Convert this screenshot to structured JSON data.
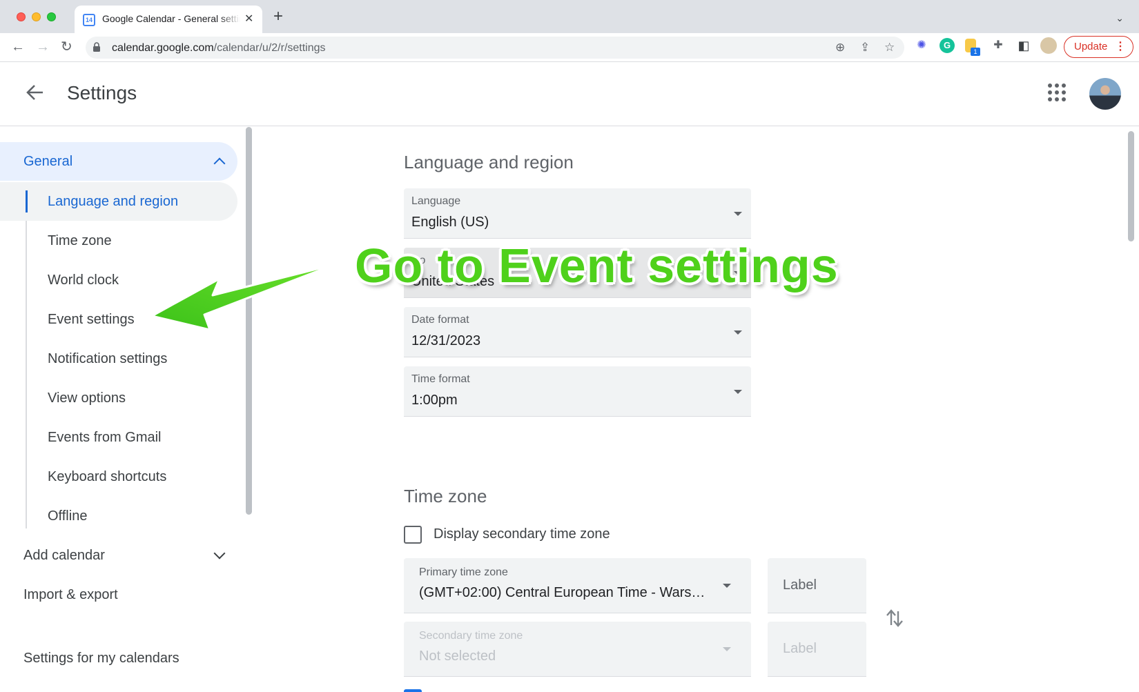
{
  "browser": {
    "tab_title": "Google Calendar - General settings",
    "tab_favicon_text": "14",
    "url_host": "calendar.google.com",
    "url_path": "/calendar/u/2/r/settings",
    "update_label": "Update",
    "extension_badge": "1"
  },
  "header": {
    "title": "Settings"
  },
  "sidebar": {
    "general_label": "General",
    "sub_items": [
      "Language and region",
      "Time zone",
      "World clock",
      "Event settings",
      "Notification settings",
      "View options",
      "Events from Gmail",
      "Keyboard shortcuts",
      "Offline"
    ],
    "add_calendar": "Add calendar",
    "import_export": "Import & export",
    "settings_for_my_calendars": "Settings for my calendars"
  },
  "language_region": {
    "title": "Language and region",
    "language_label": "Language",
    "language_value": "English (US)",
    "country_label": "Co",
    "country_value": "United States",
    "date_format_label": "Date format",
    "date_format_value": "12/31/2023",
    "time_format_label": "Time format",
    "time_format_value": "1:00pm"
  },
  "time_zone": {
    "title": "Time zone",
    "secondary_checkbox_label": "Display secondary time zone",
    "primary_label": "Primary time zone",
    "primary_value": "(GMT+02:00) Central European Time - Wars…",
    "primary_tag_placeholder": "Label",
    "secondary_label": "Secondary time zone",
    "secondary_value": "Not selected",
    "secondary_tag_placeholder": "Label"
  },
  "annotation": {
    "text": "Go to Event settings",
    "color": "#4fd11b"
  },
  "colors": {
    "accent": "#1967d2",
    "active_bg": "#e8f0fe"
  }
}
